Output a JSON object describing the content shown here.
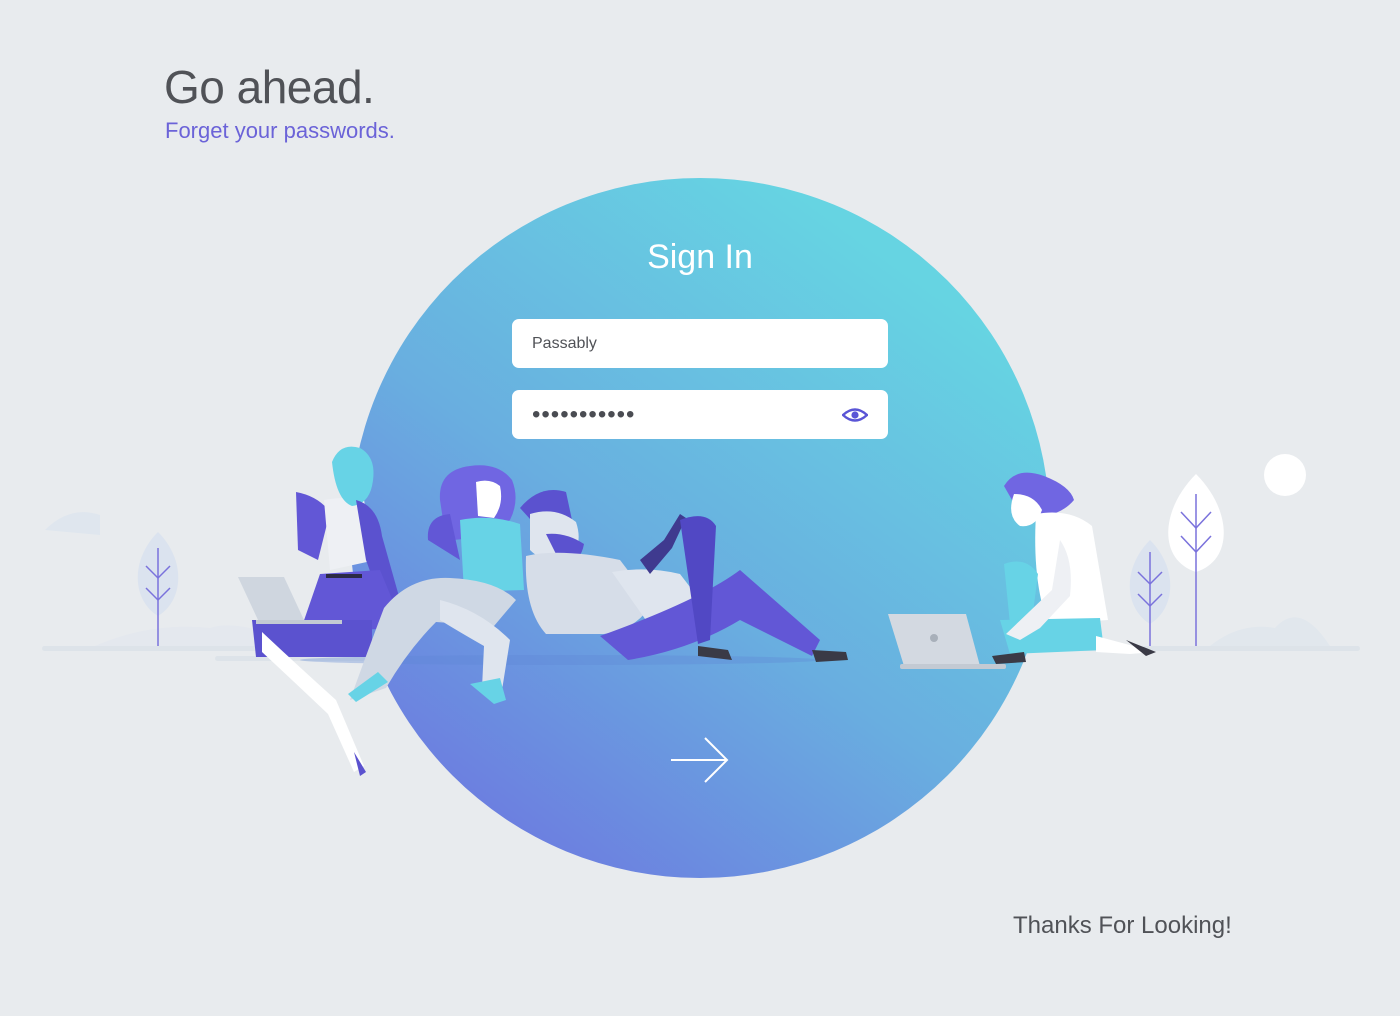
{
  "header": {
    "title": "Go ahead.",
    "subtitle": "Forget your passwords."
  },
  "form": {
    "title": "Sign In",
    "username_value": "Passably",
    "password_mask": "•••••••••••",
    "reveal_icon": "eye-icon",
    "submit_icon": "arrow-right-icon"
  },
  "footer": {
    "text": "Thanks For Looking!"
  },
  "colors": {
    "background": "#e8ebee",
    "circle_top": "#66d4e2",
    "circle_bottom": "#6c7ee0",
    "accent": "#5a55d6",
    "text": "#505257"
  }
}
